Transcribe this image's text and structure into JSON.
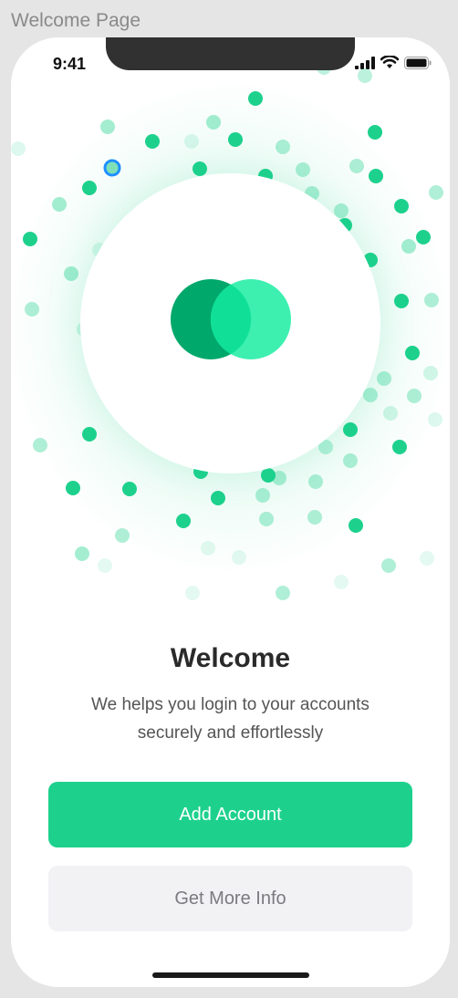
{
  "frame_label": "Welcome Page",
  "status_bar": {
    "time": "9:41"
  },
  "welcome": {
    "title": "Welcome",
    "subtitle_line1": "We helps you login to your accounts",
    "subtitle_line2": "securely and effortlessly"
  },
  "actions": {
    "primary_label": "Add Account",
    "secondary_label": "Get More Info"
  },
  "colors": {
    "accent": "#1dd18d",
    "logo_dark": "#00a86b",
    "logo_light": "#3df0b0",
    "secondary_bg": "#f2f2f5"
  }
}
